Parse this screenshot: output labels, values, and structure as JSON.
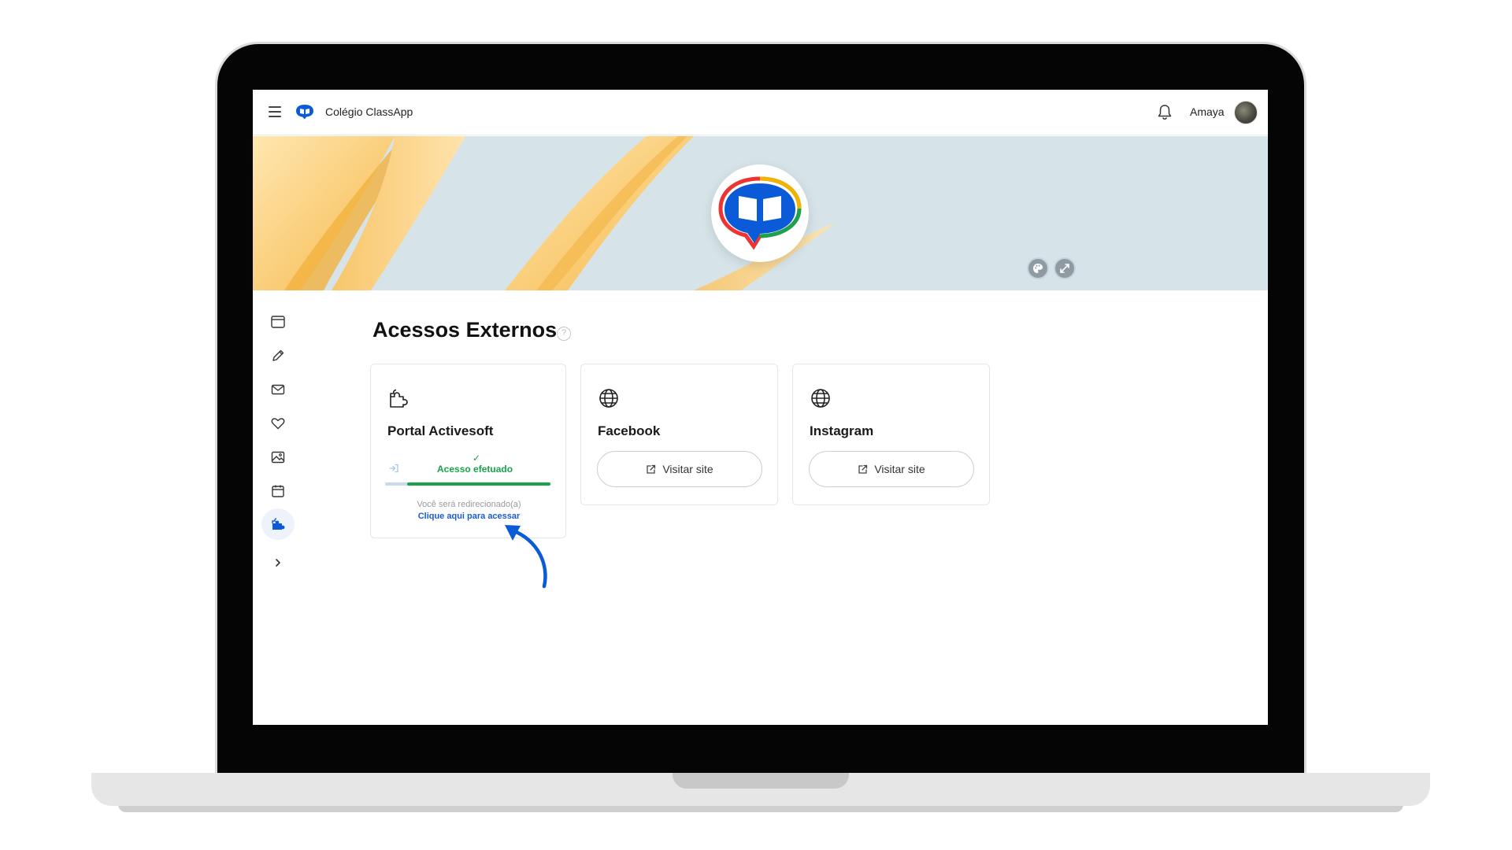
{
  "app": {
    "name": "Colégio ClassApp",
    "user_name": "Amaya"
  },
  "colors": {
    "brand_blue": "#0b5bd9",
    "success_green": "#1aa34a",
    "link_blue": "#1a5bd6"
  },
  "icons": {
    "menu": "menu-icon",
    "bell": "bell-icon",
    "palette": "palette-icon",
    "expand": "expand-icon",
    "help": "help-circle-icon",
    "puzzle": "puzzle-icon",
    "globe": "globe-icon",
    "external": "external-link-icon"
  },
  "sidebar": {
    "items": [
      {
        "name": "browser-window",
        "icon": "browser-window-icon"
      },
      {
        "name": "pencil",
        "icon": "pencil-icon"
      },
      {
        "name": "mail",
        "icon": "mail-icon"
      },
      {
        "name": "heart",
        "icon": "heart-icon"
      },
      {
        "name": "image",
        "icon": "image-icon"
      },
      {
        "name": "calendar",
        "icon": "calendar-icon"
      },
      {
        "name": "external-access",
        "icon": "puzzle-icon",
        "active": true
      },
      {
        "name": "expand",
        "icon": "chevron-right-icon"
      }
    ]
  },
  "main": {
    "title": "Acessos Externos",
    "help": "?",
    "cards": [
      {
        "title": "Portal Activesoft",
        "icon": "puzzle-icon",
        "status_check": "✓",
        "status": "Acesso efetuado",
        "progress": 0.82,
        "redirect_text": "Você será redirecionado(a)",
        "link_text": "Clique aqui para acessar"
      },
      {
        "title": "Facebook",
        "icon": "globe-icon",
        "button_label": "Visitar site"
      },
      {
        "title": "Instagram",
        "icon": "globe-icon",
        "button_label": "Visitar site"
      }
    ]
  }
}
